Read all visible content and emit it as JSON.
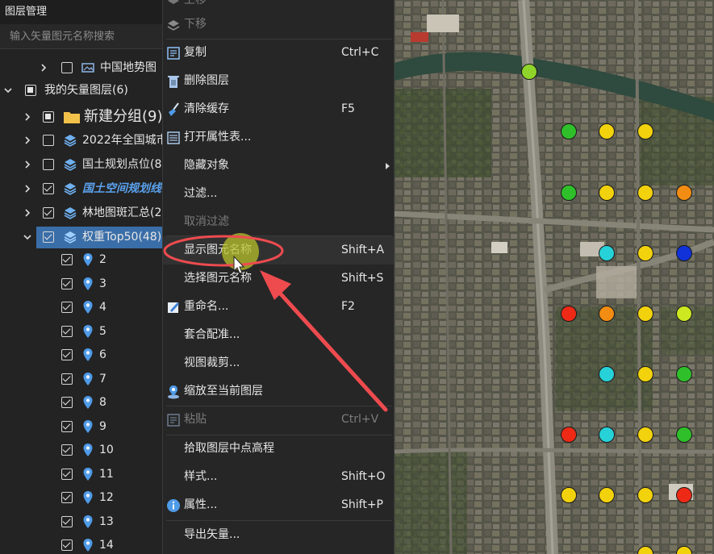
{
  "panel": {
    "title": "图层管理",
    "search_placeholder": "输入矢量图元名称搜索"
  },
  "tree": {
    "basemap_group": "中国地势图",
    "vector_root": "我的矢量图层(6)",
    "layers": [
      {
        "label": "新建分组(9)",
        "type": "folder"
      },
      {
        "label": "2022年全国城市",
        "type": "layer"
      },
      {
        "label": "国土规划点位(8",
        "type": "layer"
      },
      {
        "label": "国土空间规划线",
        "type": "layer"
      },
      {
        "label": "林地图斑汇总(2",
        "type": "layer"
      },
      {
        "label": "权重Top50(48)",
        "type": "layer"
      }
    ],
    "points": [
      "2",
      "3",
      "4",
      "5",
      "6",
      "7",
      "8",
      "9",
      "10",
      "11",
      "12",
      "13",
      "14"
    ]
  },
  "context_menu": {
    "items": [
      {
        "key": "move-up",
        "label": "上移",
        "shortcut": "",
        "disabled": true
      },
      {
        "key": "move-down",
        "label": "下移",
        "shortcut": "",
        "disabled": true
      },
      {
        "key": "copy",
        "label": "复制",
        "shortcut": "Ctrl+C",
        "disabled": false
      },
      {
        "key": "delete-layer",
        "label": "删除图层",
        "shortcut": "",
        "disabled": false
      },
      {
        "key": "clear-cache",
        "label": "清除缓存",
        "shortcut": "F5",
        "disabled": false
      },
      {
        "key": "open-attribute-table",
        "label": "打开属性表...",
        "shortcut": "",
        "disabled": false
      },
      {
        "key": "hide-objects",
        "label": "隐藏对象",
        "shortcut": "",
        "disabled": false,
        "submenu": true
      },
      {
        "key": "filter",
        "label": "过滤...",
        "shortcut": "",
        "disabled": false
      },
      {
        "key": "cancel-filter",
        "label": "取消过滤",
        "shortcut": "",
        "disabled": true
      },
      {
        "key": "show-feature-names",
        "label": "显示图元名称",
        "shortcut": "Shift+A",
        "disabled": false,
        "hover": true
      },
      {
        "key": "select-feature-names",
        "label": "选择图元名称",
        "shortcut": "Shift+S",
        "disabled": false
      },
      {
        "key": "rename",
        "label": "重命名...",
        "shortcut": "F2",
        "disabled": false
      },
      {
        "key": "register",
        "label": "套合配准...",
        "shortcut": "",
        "disabled": false
      },
      {
        "key": "view-clip",
        "label": "视图裁剪...",
        "shortcut": "",
        "disabled": false
      },
      {
        "key": "zoom-to-layer",
        "label": "缩放至当前图层",
        "shortcut": "",
        "disabled": false
      },
      {
        "key": "paste",
        "label": "粘贴",
        "shortcut": "Ctrl+V",
        "disabled": true
      },
      {
        "key": "pick-center-elevation",
        "label": "拾取图层中点高程",
        "shortcut": "",
        "disabled": false
      },
      {
        "key": "style",
        "label": "样式...",
        "shortcut": "Shift+O",
        "disabled": false
      },
      {
        "key": "properties",
        "label": "属性...",
        "shortcut": "Shift+P",
        "disabled": false
      },
      {
        "key": "export-vector",
        "label": "导出矢量...",
        "shortcut": "",
        "disabled": false
      }
    ]
  },
  "map": {
    "marker_colors": {
      "green": "#2fbf2a",
      "yellow": "#f2d20c",
      "orange": "#f28c12",
      "red": "#ee2a16",
      "cyan": "#26d2d8",
      "blue": "#1032d8",
      "lime": "#cde820",
      "lightgreen": "#8fd42a"
    }
  },
  "colors": {
    "selection": "#3a6ea8",
    "annotation": "#ee4b4f",
    "highlight": "#b8c02a"
  }
}
